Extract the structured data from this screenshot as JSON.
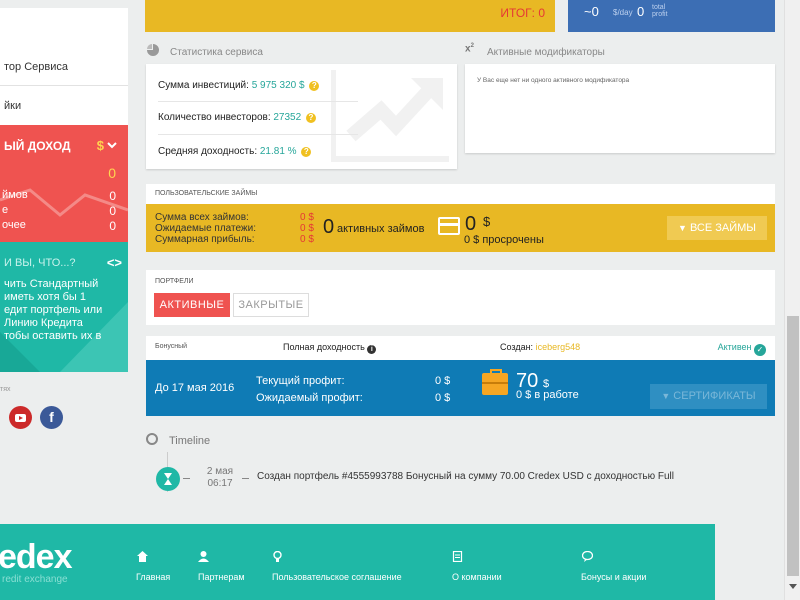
{
  "sidebar": {
    "items": [
      {
        "label": "тор Сервиса"
      },
      {
        "label": "йки"
      }
    ],
    "income": {
      "title": "ЫЙ ДОХОД",
      "currency": "$",
      "big_value": "0",
      "rows": [
        {
          "label": "ймов",
          "value": "0"
        },
        {
          "label": "е",
          "value": "0"
        },
        {
          "label": "очее",
          "value": "0"
        }
      ]
    },
    "tip": {
      "title": "И ВЫ, ЧТО...?",
      "arrows": "<>",
      "text": "чить Стандартный\nиметь хотя бы 1\nедит портфель или\nЛинию Кредита\nтобы оставить их в"
    },
    "social": {
      "label": "тях",
      "facebook_letter": "f"
    }
  },
  "top": {
    "total": "ИТОГ: 0",
    "per_day_value": "~0",
    "per_day_unit": "$/day",
    "profit_value": "0",
    "profit_unit": "total profit"
  },
  "stats": {
    "heading": "Статистика сервиса",
    "rows": [
      {
        "label": "Сумма инвестиций:",
        "value": "5 975 320 $"
      },
      {
        "label": "Количество инвесторов:",
        "value": "27352"
      },
      {
        "label": "Средняя доходность:",
        "value": "21.81 %"
      }
    ],
    "help_glyph": "?"
  },
  "modifiers": {
    "heading": "Активные модификаторы",
    "empty_text": "У Вас еще нет ни одного активного модификатора"
  },
  "loans": {
    "heading": "ПОЛЬЗОВАТЕЛЬСКИЕ ЗАЙМЫ",
    "labels": [
      "Сумма всех займов:",
      "Ожидаемые платежи:",
      "Суммарная прибыль:"
    ],
    "values": [
      "0 $",
      "0 $",
      "0 $"
    ],
    "active_count": "0",
    "active_label": "активных займов",
    "amount": "0",
    "amount_currency": "$",
    "overdue": "0 $ просрочены",
    "all_button": "ВСЕ ЗАЙМЫ"
  },
  "portfolios": {
    "heading": "ПОРТФЕЛИ",
    "tab_active": "АКТИВНЫЕ",
    "tab_closed": "ЗАКРЫТЫЕ",
    "item": {
      "type": "Бонусный",
      "yield_label": "Полная доходность",
      "info_glyph": "i",
      "creator_label": "Создан:",
      "creator_name": "iceberg548",
      "status": "Активен",
      "until": "До 17 мая 2016",
      "profit_labels": [
        "Текущий профит:",
        "Ожидаемый профит:"
      ],
      "profit_values": [
        "0 $",
        "0 $"
      ],
      "amount": "70",
      "amount_currency": "$",
      "in_work": "0 $ в работе",
      "cert_button": "СЕРТИФИКАТЫ"
    }
  },
  "timeline": {
    "heading": "Timeline",
    "event_date": "2 мая",
    "event_time": "06:17",
    "event_text": "Создан портфель #4555993788 Бонусный на сумму 70.00 Credex USD с доходностью Full"
  },
  "footer": {
    "logo": "edex",
    "tagline": "redit exchange",
    "links": [
      {
        "label": "Главная",
        "icon": "home-icon"
      },
      {
        "label": "Партнерам",
        "icon": "user-icon"
      },
      {
        "label": "Пользовательское соглашение",
        "icon": "lightbulb-icon"
      },
      {
        "label": "О компании",
        "icon": "document-icon"
      },
      {
        "label": "Бонусы и акции",
        "icon": "chat-icon"
      }
    ]
  },
  "colors": {
    "yellow": "#e8b824",
    "red": "#ef5350",
    "teal": "#1fb8a6",
    "blue": "#0f7bb5",
    "top_blue": "#3c6eb4"
  }
}
